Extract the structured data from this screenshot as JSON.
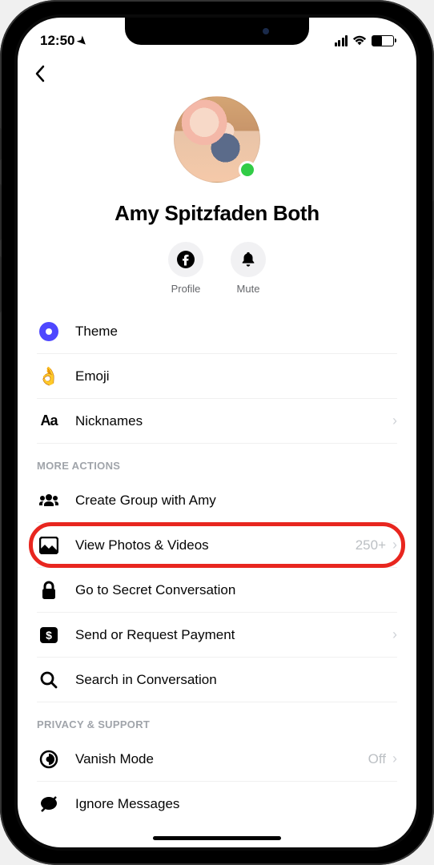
{
  "status": {
    "time": "12:50"
  },
  "profile": {
    "name": "Amy Spitzfaden Both"
  },
  "actions": {
    "profile_label": "Profile",
    "mute_label": "Mute"
  },
  "settings1": [
    {
      "icon": "theme",
      "label": "Theme",
      "chevron": false
    },
    {
      "icon": "emoji",
      "label": "Emoji",
      "chevron": false
    },
    {
      "icon": "nicknames",
      "label": "Nicknames",
      "chevron": true
    }
  ],
  "sections": {
    "more_actions": "MORE ACTIONS",
    "privacy_support": "PRIVACY & SUPPORT"
  },
  "more_actions": [
    {
      "icon": "group",
      "label": "Create Group with Amy",
      "value": "",
      "chevron": false,
      "highlight": false
    },
    {
      "icon": "photos",
      "label": "View Photos & Videos",
      "value": "250+",
      "chevron": true,
      "highlight": true
    },
    {
      "icon": "lock",
      "label": "Go to Secret Conversation",
      "value": "",
      "chevron": false,
      "highlight": false
    },
    {
      "icon": "payment",
      "label": "Send or Request Payment",
      "value": "",
      "chevron": true,
      "highlight": false
    },
    {
      "icon": "search",
      "label": "Search in Conversation",
      "value": "",
      "chevron": false,
      "highlight": false
    }
  ],
  "privacy": [
    {
      "icon": "vanish",
      "label": "Vanish Mode",
      "value": "Off",
      "chevron": true
    },
    {
      "icon": "ignore",
      "label": "Ignore Messages",
      "value": "",
      "chevron": false
    }
  ]
}
